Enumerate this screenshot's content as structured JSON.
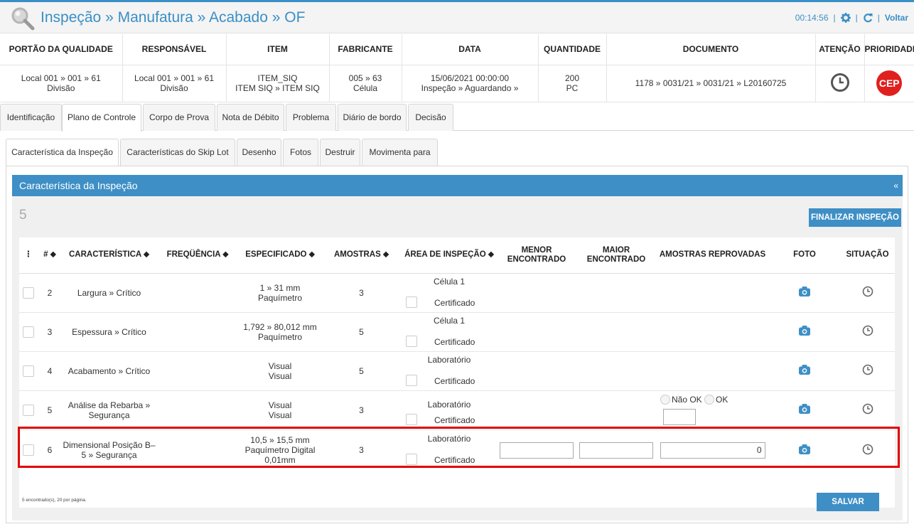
{
  "header": {
    "title": "Inspeção » Manufatura » Acabado » OF",
    "timer": "00:14:56",
    "separator": "|",
    "back_label": "Voltar",
    "icons": [
      "search-icon",
      "gear-icon",
      "refresh-icon"
    ]
  },
  "info": {
    "headers": [
      "PORTÃO DA QUALIDADE",
      "RESPONSÁVEL",
      "ITEM",
      "FABRICANTE",
      "DATA",
      "QUANTIDADE",
      "DOCUMENTO",
      "ATENÇÃO",
      "PRIORIDADE"
    ],
    "gate": [
      "Local 001 » 001 » 61",
      "Divisão"
    ],
    "responsible": [
      "Local 001 » 001 » 61",
      "Divisão"
    ],
    "item": [
      "ITEM_SIQ",
      "ITEM SIQ » ITEM SIQ"
    ],
    "maker": [
      "005 » 63",
      "Célula"
    ],
    "date": [
      "15/06/2021 00:00:00",
      "Inspeção » Aguardando »"
    ],
    "quantity": [
      "200",
      "PC"
    ],
    "document": "1178 » 0031/21 » 0031/21 » L20160725",
    "priority_badge": "CEP"
  },
  "tabs_main": [
    "Identificação",
    "Plano de Controle",
    "Corpo de Prova",
    "Nota de Débito",
    "Problema",
    "Diário de bordo",
    "Decisão"
  ],
  "tabs_sub": [
    "Característica da Inspeção",
    "Características do Skip Lot",
    "Desenho",
    "Fotos",
    "Destruir",
    "Movimenta para"
  ],
  "panel": {
    "title": "Característica da Inspeção",
    "collapse": "«",
    "count": "5",
    "finalize_label": "FINALIZAR INSPEÇÃO",
    "save_label": "SALVAR",
    "footer_note": "5 encontrado(s), 20 por página."
  },
  "grid": {
    "headers": {
      "menu": "⋮",
      "num": "# ⬥",
      "characteristic": "CARACTERÍSTICA ⬥",
      "frequency": "FREQÜÊNCIA ⬥",
      "specified": "ESPECIFICADO ⬥",
      "samples": "AMOSTRAS ⬥",
      "area": "ÁREA DE INSPEÇÃO ⬥",
      "min_found": "MENOR ENCONTRADO",
      "max_found": "MAIOR ENCONTRADO",
      "rejected": "AMOSTRAS REPROVADAS",
      "photo": "FOTO",
      "status": "SITUAÇÃO"
    },
    "certified_label": "Certificado",
    "radio_nok": "Não OK",
    "radio_ok": "OK",
    "rows": [
      {
        "num": "2",
        "characteristic": "Largura » Crítico",
        "spec1": "1 » 31 mm",
        "spec2": "Paquímetro",
        "spec3": "",
        "samples": "3",
        "area": "Célula 1"
      },
      {
        "num": "3",
        "characteristic": "Espessura » Crítico",
        "spec1": "1,792 » 80,012 mm",
        "spec2": "Paquímetro",
        "spec3": "",
        "samples": "5",
        "area": "Célula 1"
      },
      {
        "num": "4",
        "characteristic": "Acabamento » Crítico",
        "spec1": "Visual",
        "spec2": "Visual",
        "spec3": "",
        "samples": "5",
        "area": "Laboratório"
      },
      {
        "num": "5",
        "characteristic": "Análise da Rebarba » Segurança",
        "spec1": "Visual",
        "spec2": "Visual",
        "spec3": "",
        "samples": "3",
        "area": "Laboratório"
      },
      {
        "num": "6",
        "characteristic": "Dimensional Posição B–5 » Segurança",
        "spec1": "10,5 » 15,5 mm",
        "spec2": "Paquímetro Digital",
        "spec3": "0,01mm",
        "samples": "3",
        "area": "Laboratório",
        "rejected_value": "0"
      }
    ]
  },
  "colors": {
    "accent": "#3e8fc5",
    "badge": "#e0201e",
    "highlight": "#e00000"
  }
}
